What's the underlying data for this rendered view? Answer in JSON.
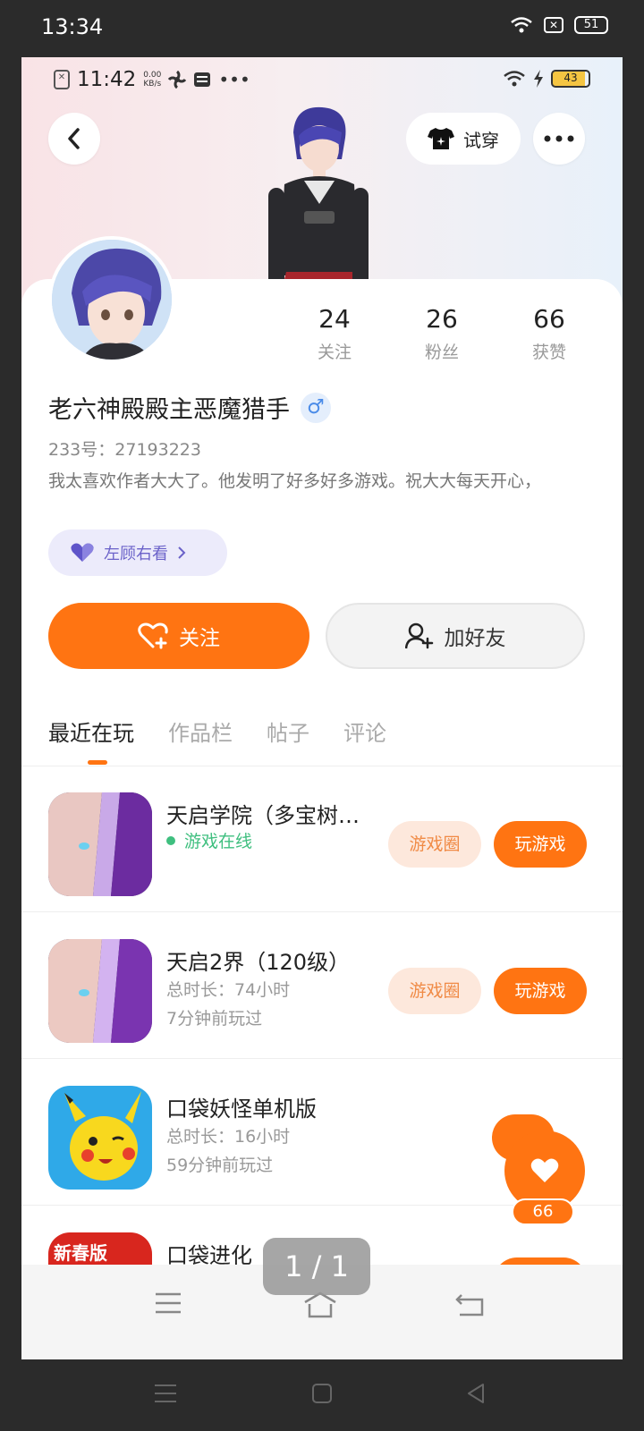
{
  "outer_status": {
    "time": "13:34",
    "battery": "51"
  },
  "inner_status": {
    "time": "11:42",
    "speed_top": "0.00",
    "speed_bottom": "KB/s",
    "battery": "43"
  },
  "header": {
    "tryon_label": "试穿"
  },
  "stats": [
    {
      "num": "24",
      "label": "关注"
    },
    {
      "num": "26",
      "label": "粉丝"
    },
    {
      "num": "66",
      "label": "获赞"
    }
  ],
  "profile": {
    "name": "老六神殿殿主恶魔猎手",
    "gender_symbol": "♂",
    "uid": "233号：27193223",
    "bio": "我太喜欢作者大大了。他发明了好多好多游戏。祝大大每天开心，",
    "tag": "左顾右看"
  },
  "actions": {
    "follow": "关注",
    "add_friend": "加好友"
  },
  "tabs": [
    "最近在玩",
    "作品栏",
    "帖子",
    "评论"
  ],
  "games": [
    {
      "title": "天启学院（多宝树…",
      "line1": "游戏在线",
      "line2": "",
      "btn_circle": "游戏圈",
      "btn_play": "玩游戏"
    },
    {
      "title": "天启2界（120级）",
      "line1": "总时长：74小时",
      "line2": "7分钟前玩过",
      "btn_circle": "游戏圈",
      "btn_play": "玩游戏"
    },
    {
      "title": "口袋妖怪单机版",
      "line1": "总时长：16小时",
      "line2": "59分钟前玩过"
    },
    {
      "title": "口袋进化",
      "icon_badge": "新春版"
    }
  ],
  "like_float": {
    "count": "66"
  },
  "page_counter": "1 / 1",
  "colors": {
    "accent": "#ff7412",
    "online": "#3fbf7f",
    "tag_purple": "#6b62c9"
  }
}
